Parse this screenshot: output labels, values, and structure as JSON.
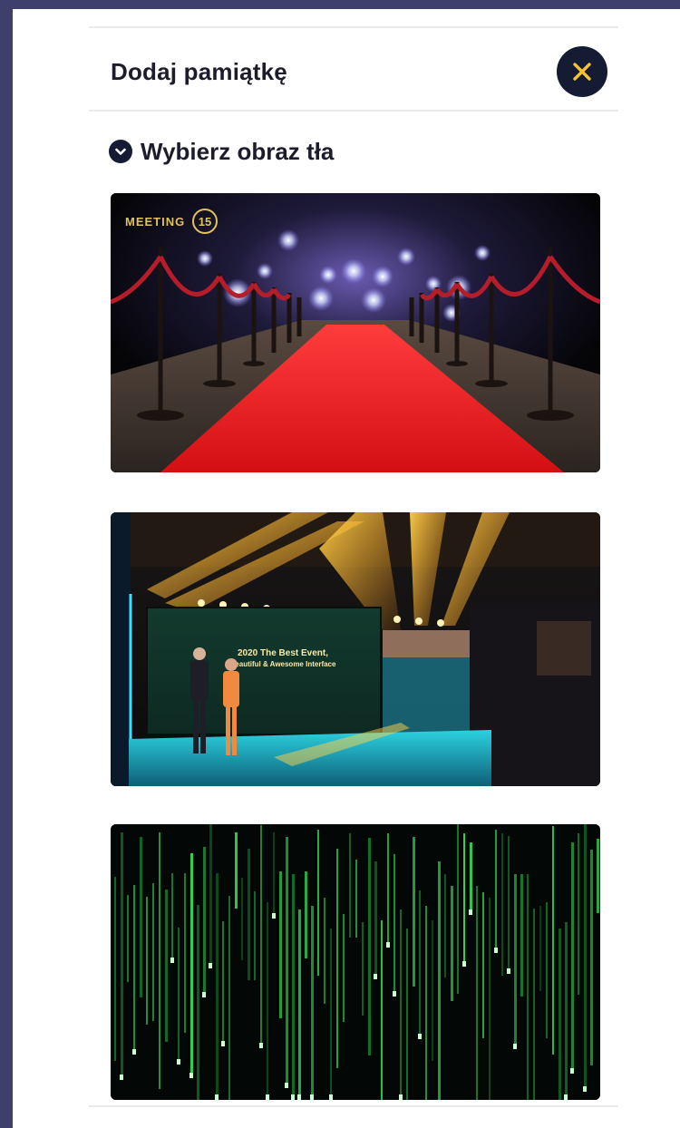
{
  "modal": {
    "title": "Dodaj pamiątkę",
    "close_icon": "close-x-icon"
  },
  "section": {
    "title": "Wybierz obraz tła",
    "icon": "chevron-down-circle-icon"
  },
  "backgrounds": [
    {
      "id": "red-carpet",
      "logo_text": "MEETING",
      "logo_number": "15"
    },
    {
      "id": "stage",
      "screen_line1": "2020 The Best Event,",
      "screen_line2": "Beautiful & Awesome Interface"
    },
    {
      "id": "matrix"
    }
  ],
  "colors": {
    "accent": "#f4c430",
    "dark": "#141b33",
    "frame": "#3f3f6c"
  }
}
